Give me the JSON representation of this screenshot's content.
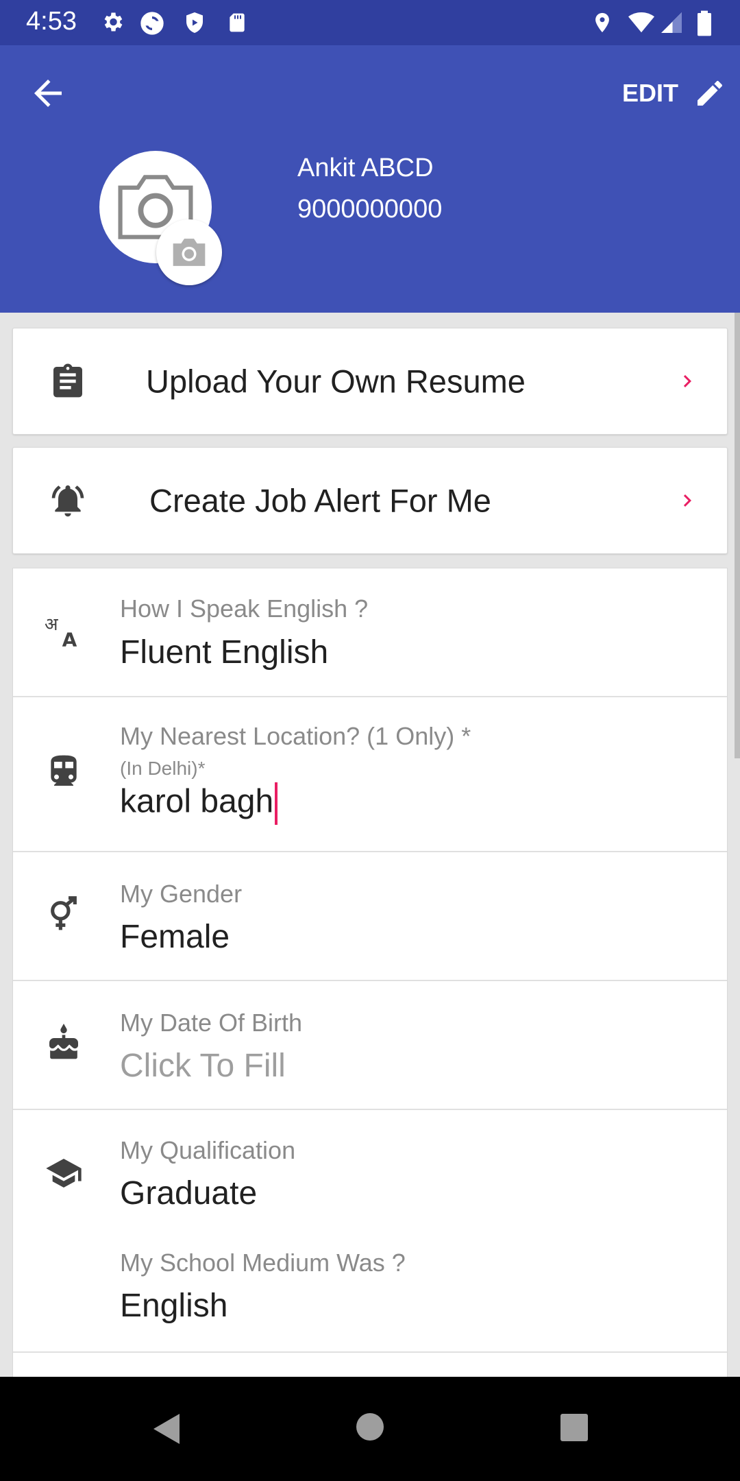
{
  "status_bar": {
    "time": "4:53",
    "left_icons": [
      "settings-icon",
      "sync-icon",
      "shield-icon",
      "sd-card-icon"
    ],
    "right_icons": [
      "location-icon",
      "wifi-icon",
      "signal-icon",
      "battery-icon"
    ]
  },
  "app_bar": {
    "back_icon": "arrow-back-icon",
    "edit_label": "EDIT",
    "edit_icon": "pencil-icon",
    "profile": {
      "name": "Ankit ABCD",
      "phone": "9000000000"
    },
    "avatar_icon": "camera-icon"
  },
  "actions": [
    {
      "label": "Upload Your Own Resume",
      "icon": "clipboard-icon"
    },
    {
      "label": "Create Job Alert For Me",
      "icon": "bell-ring-icon"
    }
  ],
  "form": {
    "english": {
      "hint": "How I Speak English ?",
      "value": "Fluent English",
      "icon": "translate-icon"
    },
    "location": {
      "hint": "My Nearest Location? (1 Only) *",
      "subhint": "(In Delhi)*",
      "value": "karol bagh",
      "icon": "train-icon"
    },
    "gender": {
      "hint": "My Gender",
      "value": "Female",
      "icon": "gender-icon"
    },
    "dob": {
      "hint": "My Date Of Birth",
      "value": "Click To Fill",
      "icon": "cake-icon"
    },
    "qualification": {
      "hint": "My Qualification",
      "value": "Graduate",
      "icon": "school-icon"
    },
    "school_medium": {
      "hint": "My School Medium Was ?",
      "value": "English"
    }
  },
  "colors": {
    "primary": "#3f51b5",
    "status_bar": "#303f9f",
    "accent": "#e91e63",
    "nav_bar": "#000000"
  },
  "nav_bar": [
    "back-triangle-icon",
    "home-circle-icon",
    "recents-square-icon"
  ]
}
